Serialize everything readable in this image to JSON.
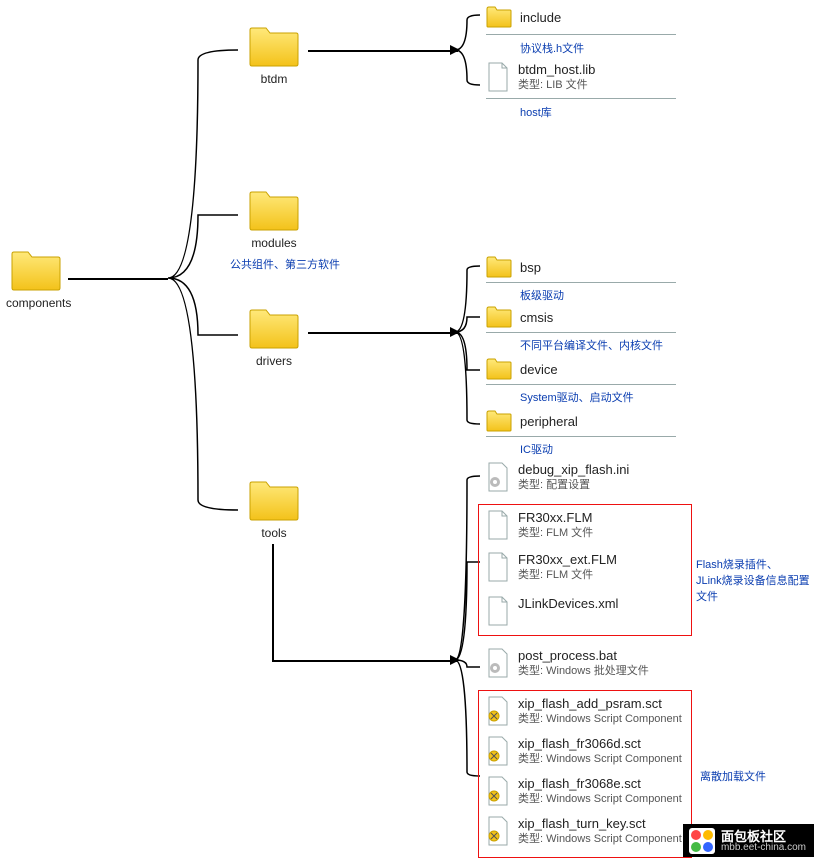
{
  "root": {
    "label": "components"
  },
  "level1": {
    "btdm": {
      "label": "btdm"
    },
    "modules": {
      "label": "modules",
      "note": "公共组件、第三方软件"
    },
    "drivers": {
      "label": "drivers"
    },
    "tools": {
      "label": "tools"
    }
  },
  "btdm_children": {
    "include": {
      "label": "include",
      "note": "协议栈.h文件"
    },
    "host_lib": {
      "name": "btdm_host.lib",
      "type": "类型: LIB 文件",
      "note": "host库"
    }
  },
  "drivers_children": {
    "bsp": {
      "label": "bsp",
      "note": "板级驱动"
    },
    "cmsis": {
      "label": "cmsis",
      "note": "不同平台编译文件、内核文件"
    },
    "device": {
      "label": "device",
      "note": "System驱动、启动文件"
    },
    "peripheral": {
      "label": "peripheral",
      "note": "IC驱动"
    }
  },
  "tools_children": {
    "debug_ini": {
      "name": "debug_xip_flash.ini",
      "type": "类型: 配置设置"
    },
    "box1": [
      {
        "name": "FR30xx.FLM",
        "type": "类型: FLM 文件"
      },
      {
        "name": "FR30xx_ext.FLM",
        "type": "类型: FLM 文件"
      },
      {
        "name": "JLinkDevices.xml",
        "type": ""
      }
    ],
    "box1_note": "Flash烧录插件、\nJLink烧录设备信息配置文件",
    "post_bat": {
      "name": "post_process.bat",
      "type": "类型: Windows 批处理文件"
    },
    "box2": [
      {
        "name": "xip_flash_add_psram.sct",
        "type": "类型: Windows Script Component"
      },
      {
        "name": "xip_flash_fr3066d.sct",
        "type": "类型: Windows Script Component"
      },
      {
        "name": "xip_flash_fr3068e.sct",
        "type": "类型: Windows Script Component"
      },
      {
        "name": "xip_flash_turn_key.sct",
        "type": "类型: Windows Script Component"
      }
    ],
    "box2_note": "离散加载文件"
  },
  "brand": {
    "title": "面包板社区",
    "url": "mbb.eet-china.com"
  }
}
